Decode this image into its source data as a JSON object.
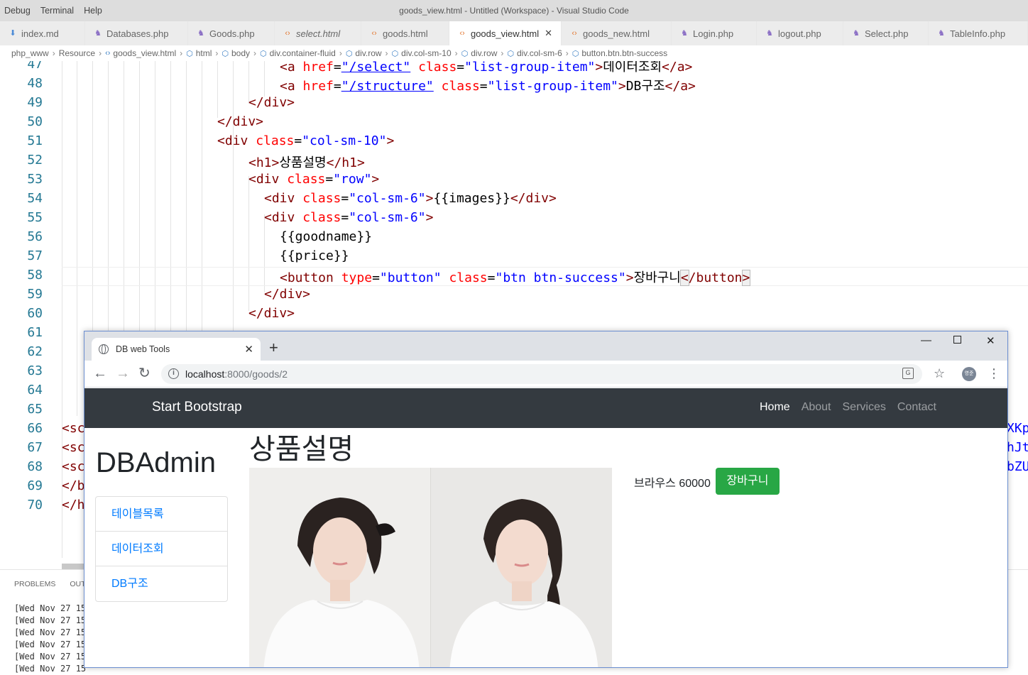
{
  "vscode": {
    "menu": [
      "Debug",
      "Terminal",
      "Help"
    ],
    "window_title": "goods_view.html - Untitled (Workspace) - Visual Studio Code",
    "tabs": [
      {
        "label": "index.md",
        "icon": "markdown-icon"
      },
      {
        "label": "Databases.php",
        "icon": "php-icon"
      },
      {
        "label": "Goods.php",
        "icon": "php-icon"
      },
      {
        "label": "select.html",
        "icon": "html-icon"
      },
      {
        "label": "goods.html",
        "icon": "html-icon"
      },
      {
        "label": "goods_view.html",
        "icon": "html-icon"
      },
      {
        "label": "goods_new.html",
        "icon": "html-icon"
      },
      {
        "label": "Login.php",
        "icon": "php-icon"
      },
      {
        "label": "logout.php",
        "icon": "php-icon"
      },
      {
        "label": "Select.php",
        "icon": "php-icon"
      },
      {
        "label": "TableInfo.php",
        "icon": "php-icon"
      }
    ],
    "breadcrumb": [
      "php_www",
      "Resource",
      "goods_view.html",
      "html",
      "body",
      "div.container-fluid",
      "div.row",
      "div.col-sm-10",
      "div.row",
      "div.col-sm-6",
      "button.btn.btn-success"
    ],
    "line_numbers": [
      "47",
      "48",
      "49",
      "50",
      "51",
      "52",
      "53",
      "54",
      "55",
      "56",
      "57",
      "58",
      "59",
      "60",
      "61",
      "62",
      "63",
      "64",
      "65",
      "66",
      "67",
      "68",
      "69",
      "70"
    ],
    "code": {
      "l47": {
        "tag": "<a ",
        "attr1": "href",
        "eq": "=",
        "val1": "\"/select\"",
        "attr2": "class",
        "val2": "\"list-group-item\"",
        "close": ">",
        "text": "데이터조회",
        "end": "</a>"
      },
      "l48": {
        "tag": "<a ",
        "attr1": "href",
        "eq": "=",
        "val1": "\"/structure\"",
        "attr2": "class",
        "val2": "\"list-group-item\"",
        "close": ">",
        "text": "DB구조",
        "end": "</a>"
      },
      "l49": "</div>",
      "l50": "</div>",
      "l51": {
        "tag": "<div ",
        "attr": "class",
        "eq": "=",
        "val": "\"col-sm-10\"",
        "close": ">"
      },
      "l52": {
        "open": "<h1>",
        "text": "상품설명",
        "end": "</h1>"
      },
      "l53": {
        "tag": "<div ",
        "attr": "class",
        "eq": "=",
        "val": "\"row\"",
        "close": ">"
      },
      "l54": {
        "tag": "<div ",
        "attr": "class",
        "eq": "=",
        "val": "\"col-sm-6\"",
        "close": ">",
        "text": "{{images}}",
        "end": "</div>"
      },
      "l55": {
        "tag": "<div ",
        "attr": "class",
        "eq": "=",
        "val": "\"col-sm-6\"",
        "close": ">"
      },
      "l56": "{{goodname}}",
      "l57": "{{price}}",
      "l58": {
        "tag": "<button ",
        "attr1": "type",
        "eq": "=",
        "val1": "\"button\"",
        "attr2": "class",
        "val2": "\"btn btn-success\"",
        "close": ">",
        "text": "장바구니",
        "end_a": "<",
        "end_b": "/button",
        "end_c": ">"
      },
      "l59": "</div>",
      "l60": "</div>",
      "l66": "<sc",
      "l67": "<sc",
      "l68": "<sc",
      "l69": "</b",
      "l70": "</h",
      "right_cut": [
        "XKp",
        "hJt",
        "bZU"
      ]
    },
    "panel": {
      "tabs": [
        "PROBLEMS",
        "OUTP"
      ],
      "log_lines": [
        "[Wed Nov 27 15",
        "[Wed Nov 27 15",
        "[Wed Nov 27 15",
        "[Wed Nov 27 15",
        "[Wed Nov 27 15",
        "[Wed Nov 27 15"
      ]
    }
  },
  "browser": {
    "tab_title": "DB web Tools",
    "url_host": "localhost",
    "url_rest": ":8000/goods/2",
    "avatar_text": "영준",
    "page": {
      "brand": "Start Bootstrap",
      "nav": [
        "Home",
        "About",
        "Services",
        "Contact"
      ],
      "sidebar_title": "DBAdmin",
      "sidebar_items": [
        "테이블목록",
        "데이터조회",
        "DB구조"
      ],
      "heading": "상품설명",
      "goodname": "브라우스",
      "price": "60000",
      "cart_button": "장바구니"
    }
  },
  "colors": {
    "cart_green": "#28a745",
    "navbar": "#343a40",
    "link_blue": "#007bff"
  }
}
